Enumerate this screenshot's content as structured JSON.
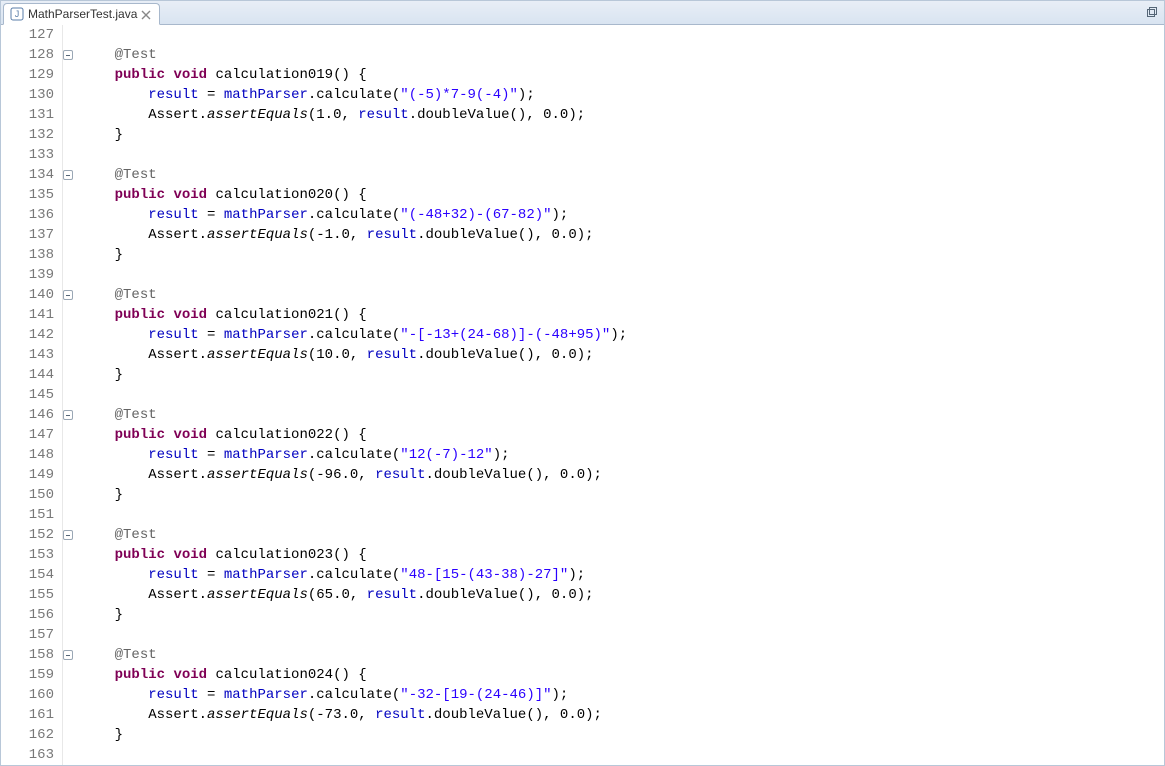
{
  "tab": {
    "filename": "MathParserTest.java",
    "icon": "java-file-icon"
  },
  "gutter": {
    "start": 127,
    "end": 163,
    "foldable_lines": [
      128,
      134,
      140,
      146,
      152,
      158
    ]
  },
  "code_lines": [
    {
      "n": 127,
      "indent": 0,
      "tokens": []
    },
    {
      "n": 128,
      "indent": 1,
      "tokens": [
        {
          "t": "ann",
          "v": "@Test"
        }
      ]
    },
    {
      "n": 129,
      "indent": 1,
      "tokens": [
        {
          "t": "kw",
          "v": "public"
        },
        {
          "t": "sp"
        },
        {
          "t": "kw",
          "v": "void"
        },
        {
          "t": "sp"
        },
        {
          "t": "id",
          "v": "calculation019() {"
        }
      ]
    },
    {
      "n": 130,
      "indent": 2,
      "tokens": [
        {
          "t": "fld",
          "v": "result"
        },
        {
          "t": "id",
          "v": " = "
        },
        {
          "t": "fld",
          "v": "mathParser"
        },
        {
          "t": "id",
          "v": ".calculate("
        },
        {
          "t": "str",
          "v": "\"(-5)*7-9(-4)\""
        },
        {
          "t": "id",
          "v": ");"
        }
      ]
    },
    {
      "n": 131,
      "indent": 2,
      "tokens": [
        {
          "t": "id",
          "v": "Assert."
        },
        {
          "t": "mth-it",
          "v": "assertEquals"
        },
        {
          "t": "id",
          "v": "(1.0, "
        },
        {
          "t": "fld",
          "v": "result"
        },
        {
          "t": "id",
          "v": ".doubleValue(), 0.0);"
        }
      ]
    },
    {
      "n": 132,
      "indent": 1,
      "tokens": [
        {
          "t": "id",
          "v": "}"
        }
      ]
    },
    {
      "n": 133,
      "indent": 0,
      "tokens": []
    },
    {
      "n": 134,
      "indent": 1,
      "tokens": [
        {
          "t": "ann",
          "v": "@Test"
        }
      ]
    },
    {
      "n": 135,
      "indent": 1,
      "tokens": [
        {
          "t": "kw",
          "v": "public"
        },
        {
          "t": "sp"
        },
        {
          "t": "kw",
          "v": "void"
        },
        {
          "t": "sp"
        },
        {
          "t": "id",
          "v": "calculation020() {"
        }
      ]
    },
    {
      "n": 136,
      "indent": 2,
      "tokens": [
        {
          "t": "fld",
          "v": "result"
        },
        {
          "t": "id",
          "v": " = "
        },
        {
          "t": "fld",
          "v": "mathParser"
        },
        {
          "t": "id",
          "v": ".calculate("
        },
        {
          "t": "str",
          "v": "\"(-48+32)-(67-82)\""
        },
        {
          "t": "id",
          "v": ");"
        }
      ]
    },
    {
      "n": 137,
      "indent": 2,
      "tokens": [
        {
          "t": "id",
          "v": "Assert."
        },
        {
          "t": "mth-it",
          "v": "assertEquals"
        },
        {
          "t": "id",
          "v": "(-1.0, "
        },
        {
          "t": "fld",
          "v": "result"
        },
        {
          "t": "id",
          "v": ".doubleValue(), 0.0);"
        }
      ]
    },
    {
      "n": 138,
      "indent": 1,
      "tokens": [
        {
          "t": "id",
          "v": "}"
        }
      ]
    },
    {
      "n": 139,
      "indent": 0,
      "tokens": []
    },
    {
      "n": 140,
      "indent": 1,
      "tokens": [
        {
          "t": "ann",
          "v": "@Test"
        }
      ]
    },
    {
      "n": 141,
      "indent": 1,
      "tokens": [
        {
          "t": "kw",
          "v": "public"
        },
        {
          "t": "sp"
        },
        {
          "t": "kw",
          "v": "void"
        },
        {
          "t": "sp"
        },
        {
          "t": "id",
          "v": "calculation021() {"
        }
      ]
    },
    {
      "n": 142,
      "indent": 2,
      "tokens": [
        {
          "t": "fld",
          "v": "result"
        },
        {
          "t": "id",
          "v": " = "
        },
        {
          "t": "fld",
          "v": "mathParser"
        },
        {
          "t": "id",
          "v": ".calculate("
        },
        {
          "t": "str",
          "v": "\"-[-13+(24-68)]-(-48+95)\""
        },
        {
          "t": "id",
          "v": ");"
        }
      ]
    },
    {
      "n": 143,
      "indent": 2,
      "tokens": [
        {
          "t": "id",
          "v": "Assert."
        },
        {
          "t": "mth-it",
          "v": "assertEquals"
        },
        {
          "t": "id",
          "v": "(10.0, "
        },
        {
          "t": "fld",
          "v": "result"
        },
        {
          "t": "id",
          "v": ".doubleValue(), 0.0);"
        }
      ]
    },
    {
      "n": 144,
      "indent": 1,
      "tokens": [
        {
          "t": "id",
          "v": "}"
        }
      ]
    },
    {
      "n": 145,
      "indent": 0,
      "tokens": []
    },
    {
      "n": 146,
      "indent": 1,
      "tokens": [
        {
          "t": "ann",
          "v": "@Test"
        }
      ]
    },
    {
      "n": 147,
      "indent": 1,
      "tokens": [
        {
          "t": "kw",
          "v": "public"
        },
        {
          "t": "sp"
        },
        {
          "t": "kw",
          "v": "void"
        },
        {
          "t": "sp"
        },
        {
          "t": "id",
          "v": "calculation022() {"
        }
      ]
    },
    {
      "n": 148,
      "indent": 2,
      "tokens": [
        {
          "t": "fld",
          "v": "result"
        },
        {
          "t": "id",
          "v": " = "
        },
        {
          "t": "fld",
          "v": "mathParser"
        },
        {
          "t": "id",
          "v": ".calculate("
        },
        {
          "t": "str",
          "v": "\"12(-7)-12\""
        },
        {
          "t": "id",
          "v": ");"
        }
      ]
    },
    {
      "n": 149,
      "indent": 2,
      "tokens": [
        {
          "t": "id",
          "v": "Assert."
        },
        {
          "t": "mth-it",
          "v": "assertEquals"
        },
        {
          "t": "id",
          "v": "(-96.0, "
        },
        {
          "t": "fld",
          "v": "result"
        },
        {
          "t": "id",
          "v": ".doubleValue(), 0.0);"
        }
      ]
    },
    {
      "n": 150,
      "indent": 1,
      "tokens": [
        {
          "t": "id",
          "v": "}"
        }
      ]
    },
    {
      "n": 151,
      "indent": 0,
      "tokens": []
    },
    {
      "n": 152,
      "indent": 1,
      "tokens": [
        {
          "t": "ann",
          "v": "@Test"
        }
      ]
    },
    {
      "n": 153,
      "indent": 1,
      "tokens": [
        {
          "t": "kw",
          "v": "public"
        },
        {
          "t": "sp"
        },
        {
          "t": "kw",
          "v": "void"
        },
        {
          "t": "sp"
        },
        {
          "t": "id",
          "v": "calculation023() {"
        }
      ]
    },
    {
      "n": 154,
      "indent": 2,
      "tokens": [
        {
          "t": "fld",
          "v": "result"
        },
        {
          "t": "id",
          "v": " = "
        },
        {
          "t": "fld",
          "v": "mathParser"
        },
        {
          "t": "id",
          "v": ".calculate("
        },
        {
          "t": "str",
          "v": "\"48-[15-(43-38)-27]\""
        },
        {
          "t": "id",
          "v": ");"
        }
      ]
    },
    {
      "n": 155,
      "indent": 2,
      "tokens": [
        {
          "t": "id",
          "v": "Assert."
        },
        {
          "t": "mth-it",
          "v": "assertEquals"
        },
        {
          "t": "id",
          "v": "(65.0, "
        },
        {
          "t": "fld",
          "v": "result"
        },
        {
          "t": "id",
          "v": ".doubleValue(), 0.0);"
        }
      ]
    },
    {
      "n": 156,
      "indent": 1,
      "tokens": [
        {
          "t": "id",
          "v": "}"
        }
      ]
    },
    {
      "n": 157,
      "indent": 0,
      "tokens": []
    },
    {
      "n": 158,
      "indent": 1,
      "tokens": [
        {
          "t": "ann",
          "v": "@Test"
        }
      ]
    },
    {
      "n": 159,
      "indent": 1,
      "tokens": [
        {
          "t": "kw",
          "v": "public"
        },
        {
          "t": "sp"
        },
        {
          "t": "kw",
          "v": "void"
        },
        {
          "t": "sp"
        },
        {
          "t": "id",
          "v": "calculation024() {"
        }
      ]
    },
    {
      "n": 160,
      "indent": 2,
      "tokens": [
        {
          "t": "fld",
          "v": "result"
        },
        {
          "t": "id",
          "v": " = "
        },
        {
          "t": "fld",
          "v": "mathParser"
        },
        {
          "t": "id",
          "v": ".calculate("
        },
        {
          "t": "str",
          "v": "\"-32-[19-(24-46)]\""
        },
        {
          "t": "id",
          "v": ");"
        }
      ]
    },
    {
      "n": 161,
      "indent": 2,
      "tokens": [
        {
          "t": "id",
          "v": "Assert."
        },
        {
          "t": "mth-it",
          "v": "assertEquals"
        },
        {
          "t": "id",
          "v": "(-73.0, "
        },
        {
          "t": "fld",
          "v": "result"
        },
        {
          "t": "id",
          "v": ".doubleValue(), 0.0);"
        }
      ]
    },
    {
      "n": 162,
      "indent": 1,
      "tokens": [
        {
          "t": "id",
          "v": "}"
        }
      ]
    },
    {
      "n": 163,
      "indent": 0,
      "tokens": []
    }
  ]
}
